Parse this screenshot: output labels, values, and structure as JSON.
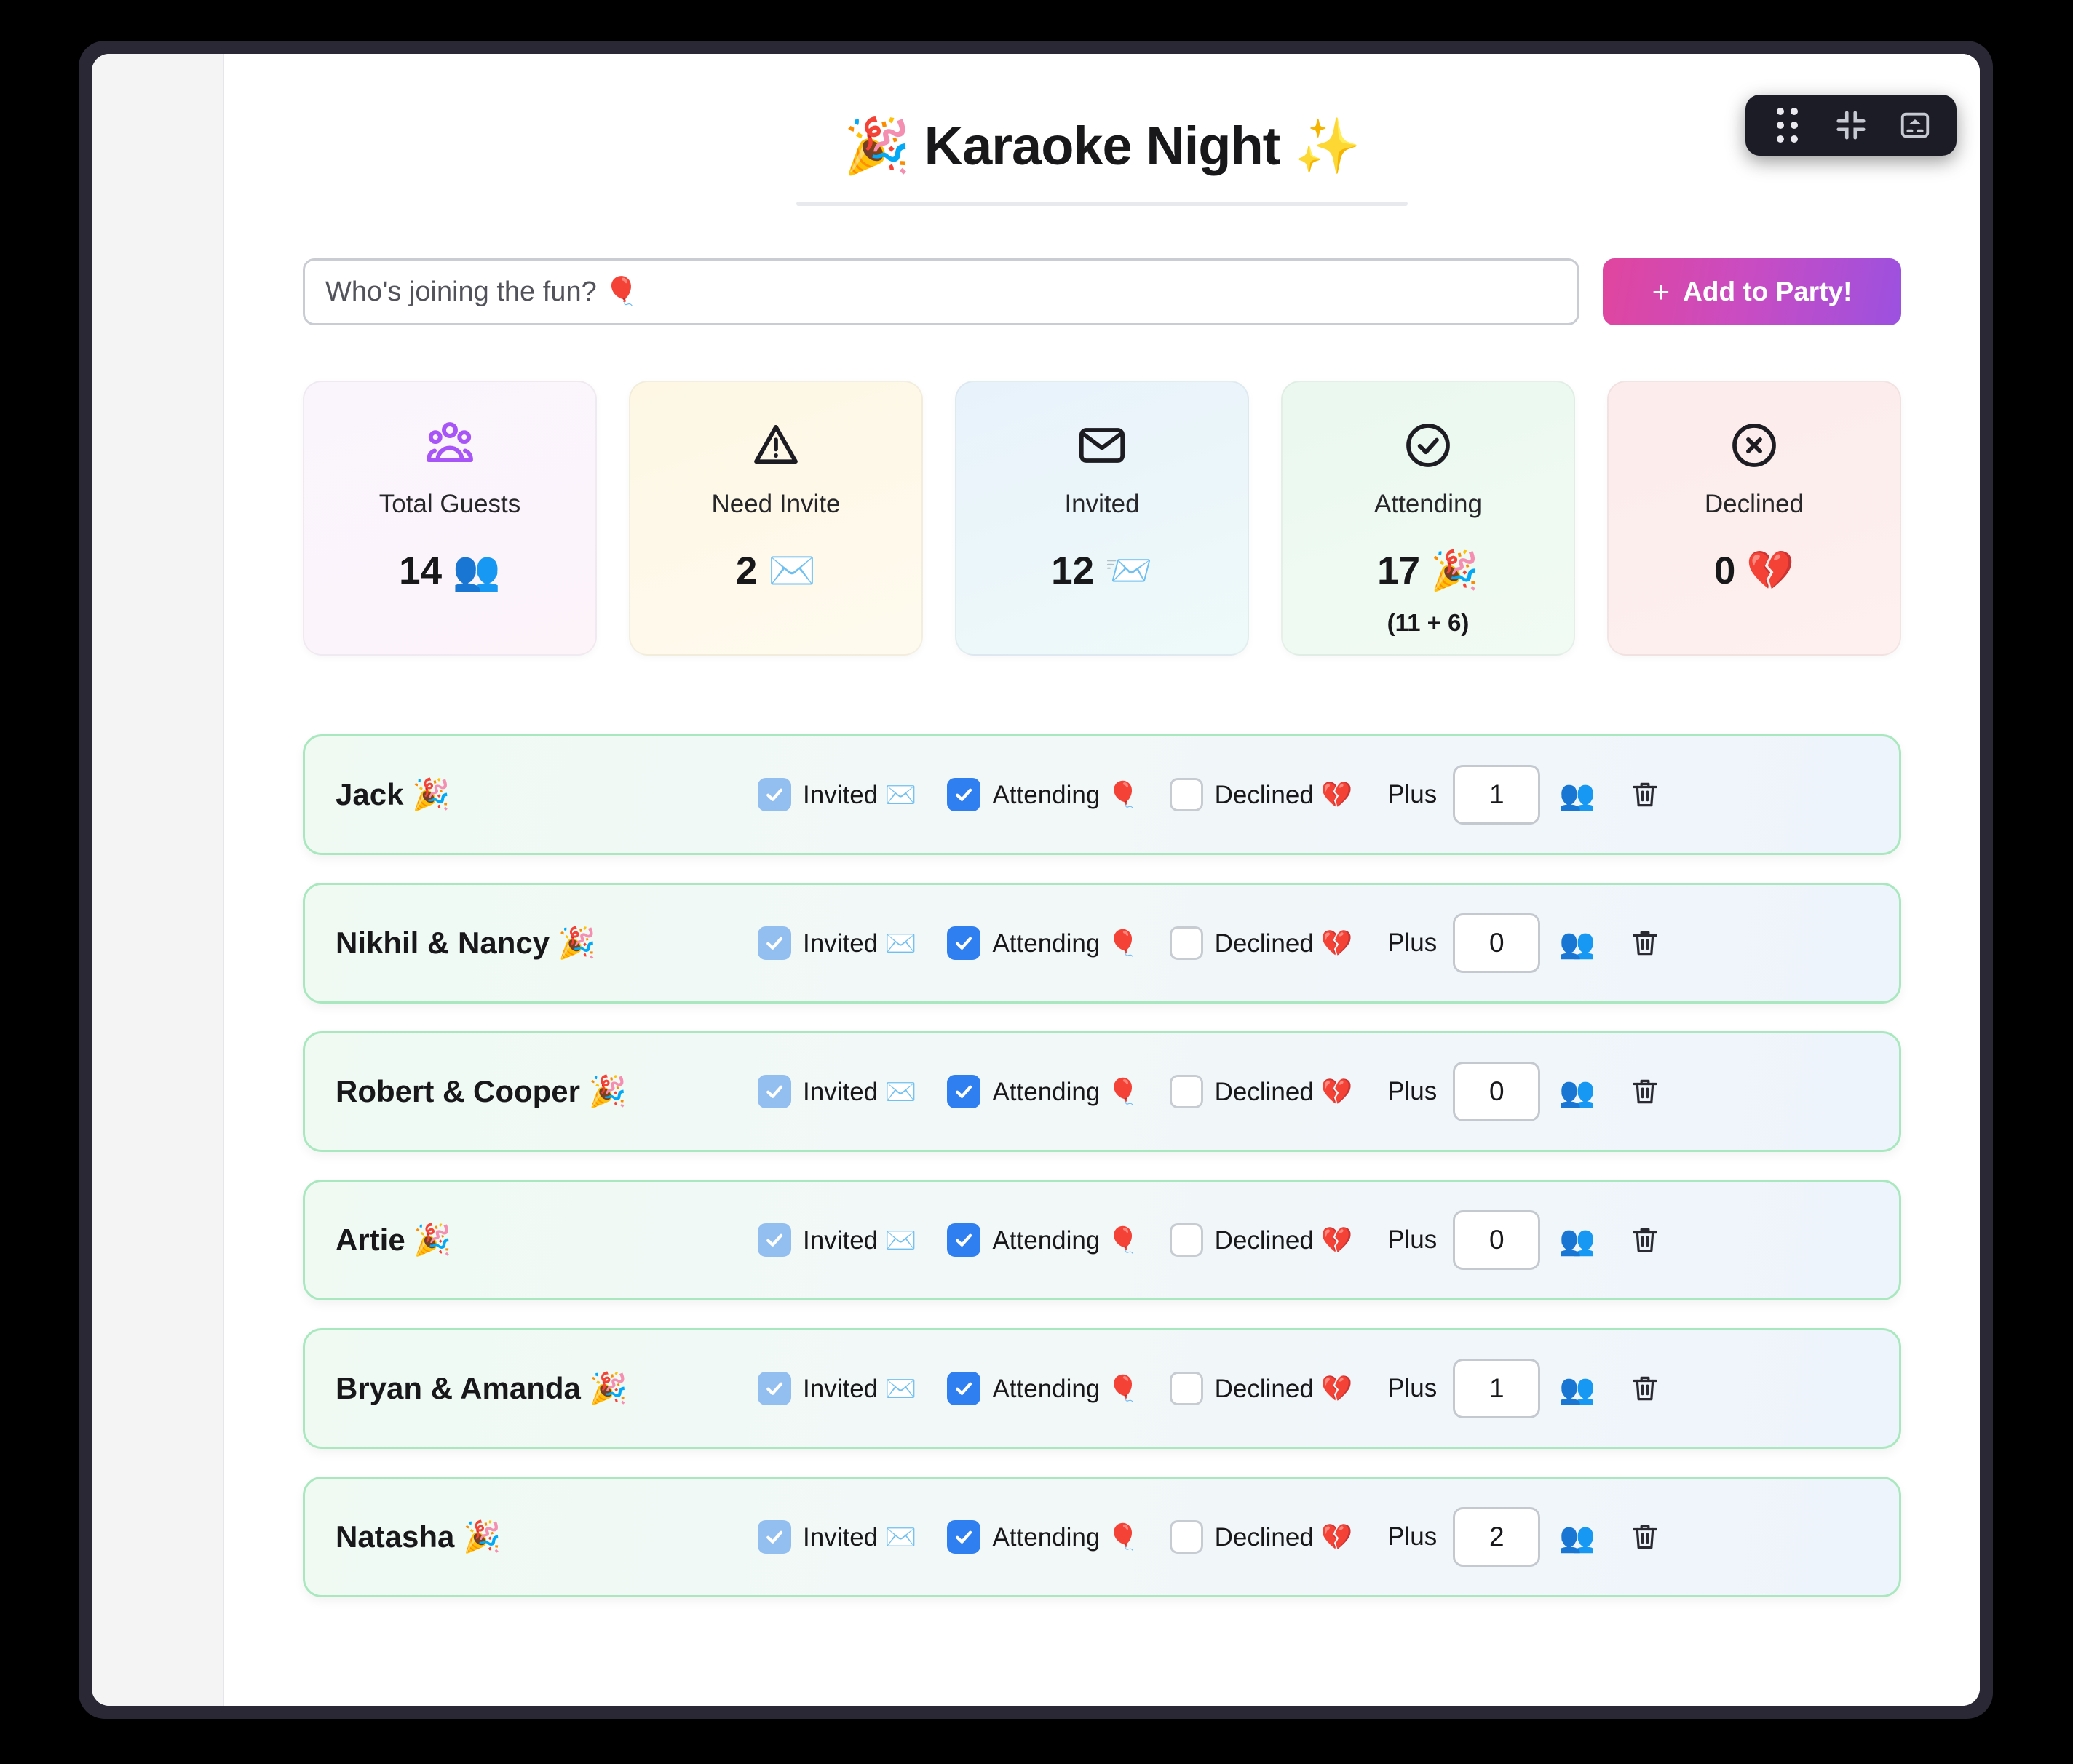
{
  "window_toolbar": {
    "drag_handle": "drag-dots",
    "collapse": "collapse-arrows",
    "keyboard": "hide-keyboard"
  },
  "header": {
    "title": "🎉 Karaoke Night ✨"
  },
  "add_guest": {
    "placeholder": "Who's joining the fun? 🎈",
    "button_plus": "+",
    "button_label": "Add to Party!"
  },
  "stats": [
    {
      "id": "total-guests",
      "icon": "users-icon",
      "label": "Total Guests",
      "value": "14 👥",
      "sub": ""
    },
    {
      "id": "need-invite",
      "icon": "warning-icon",
      "label": "Need Invite",
      "value": "2 ✉️",
      "sub": ""
    },
    {
      "id": "invited",
      "icon": "envelope-icon",
      "label": "Invited",
      "value": "12 📨",
      "sub": ""
    },
    {
      "id": "attending",
      "icon": "check-circle-icon",
      "label": "Attending",
      "value": "17 🎉",
      "sub": "(11 + 6)"
    },
    {
      "id": "declined",
      "icon": "x-circle-icon",
      "label": "Declined",
      "value": "0 💔",
      "sub": ""
    }
  ],
  "row_labels": {
    "invited": "Invited ✉️",
    "attending": "Attending 🎈",
    "declined": "Declined 💔",
    "plus": "Plus",
    "people_emoji": "👥"
  },
  "guests": [
    {
      "name": "Jack 🎉",
      "invited": true,
      "attending": true,
      "declined": false,
      "plus": "1"
    },
    {
      "name": "Nikhil & Nancy 🎉",
      "invited": true,
      "attending": true,
      "declined": false,
      "plus": "0"
    },
    {
      "name": "Robert & Cooper 🎉",
      "invited": true,
      "attending": true,
      "declined": false,
      "plus": "0"
    },
    {
      "name": "Artie 🎉",
      "invited": true,
      "attending": true,
      "declined": false,
      "plus": "0"
    },
    {
      "name": "Bryan & Amanda 🎉",
      "invited": true,
      "attending": true,
      "declined": false,
      "plus": "1"
    },
    {
      "name": "Natasha 🎉",
      "invited": true,
      "attending": true,
      "declined": false,
      "plus": "2"
    }
  ],
  "colors": {
    "accent_pink": "#e0459e",
    "accent_purple": "#9b51e0",
    "checkbox_light": "#93bff0",
    "checkbox_bright": "#2f7ff0",
    "row_border_green": "#a9e8bf",
    "users_icon_purple": "#a855f7"
  }
}
